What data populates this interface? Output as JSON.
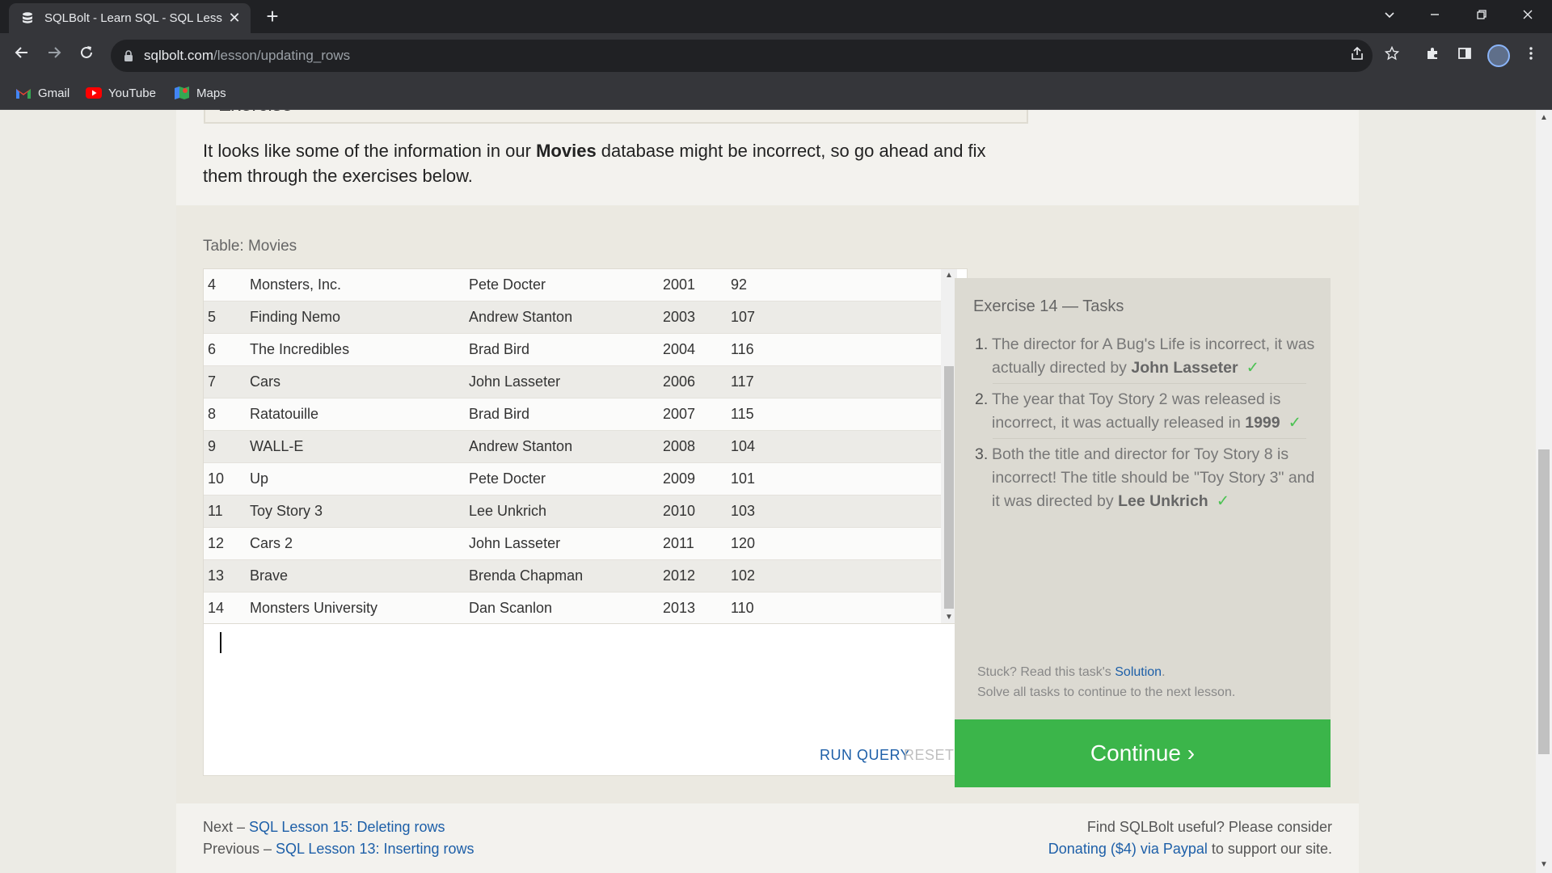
{
  "browser": {
    "tab_title": "SQLBolt - Learn SQL - SQL Lesso",
    "tab_close": "✕",
    "new_tab": "+",
    "url_host": "sqlbolt.com",
    "url_path": "/lesson/updating_rows",
    "bookmarks": [
      "Gmail",
      "YouTube",
      "Maps"
    ]
  },
  "lesson": {
    "exercise_heading": "Exercise",
    "intro_before": "It looks like some of the information in our ",
    "intro_bold": "Movies",
    "intro_after": " database might be incorrect, so go ahead and fix them through the exercises below."
  },
  "table": {
    "caption": "Table: Movies",
    "rows": [
      {
        "id": "4",
        "title": "Monsters, Inc.",
        "director": "Pete Docter",
        "year": "2001",
        "length": "92"
      },
      {
        "id": "5",
        "title": "Finding Nemo",
        "director": "Andrew Stanton",
        "year": "2003",
        "length": "107"
      },
      {
        "id": "6",
        "title": "The Incredibles",
        "director": "Brad Bird",
        "year": "2004",
        "length": "116"
      },
      {
        "id": "7",
        "title": "Cars",
        "director": "John Lasseter",
        "year": "2006",
        "length": "117"
      },
      {
        "id": "8",
        "title": "Ratatouille",
        "director": "Brad Bird",
        "year": "2007",
        "length": "115"
      },
      {
        "id": "9",
        "title": "WALL-E",
        "director": "Andrew Stanton",
        "year": "2008",
        "length": "104"
      },
      {
        "id": "10",
        "title": "Up",
        "director": "Pete Docter",
        "year": "2009",
        "length": "101"
      },
      {
        "id": "11",
        "title": "Toy Story 3",
        "director": "Lee Unkrich",
        "year": "2010",
        "length": "103"
      },
      {
        "id": "12",
        "title": "Cars 2",
        "director": "John Lasseter",
        "year": "2011",
        "length": "120"
      },
      {
        "id": "13",
        "title": "Brave",
        "director": "Brenda Chapman",
        "year": "2012",
        "length": "102"
      },
      {
        "id": "14",
        "title": "Monsters University",
        "director": "Dan Scanlon",
        "year": "2013",
        "length": "110"
      }
    ]
  },
  "editor": {
    "run_label": "RUN QUERY",
    "reset_label": "RESET"
  },
  "tasks": {
    "title": "Exercise 14 — Tasks",
    "check_mark": "✓",
    "items": [
      {
        "num": "1.",
        "text": "The director for A Bug's Life is incorrect, it was actually directed by ",
        "bold": "John Lasseter"
      },
      {
        "num": "2.",
        "text": "The year that Toy Story 2 was released is incorrect, it was actually released in ",
        "bold": "1999"
      },
      {
        "num": "3.",
        "text": "Both the title and director for Toy Story 8 is incorrect! The title should be \"Toy Story 3\" and it was directed by ",
        "bold": "Lee Unkrich"
      }
    ],
    "stuck_before": "Stuck? Read this task's ",
    "solution_link": "Solution",
    "stuck_after": ".",
    "solve_all": "Solve all tasks to continue to the next lesson.",
    "continue_label": "Continue ›"
  },
  "footer": {
    "next_prefix": "Next – ",
    "next_link": "SQL Lesson 15: Deleting rows",
    "prev_prefix": "Previous – ",
    "prev_link": "SQL Lesson 13: Inserting rows",
    "useful_text": "Find SQLBolt useful? Please consider",
    "donate_link": "Donating ($4) via Paypal",
    "donate_after": " to support our site."
  }
}
